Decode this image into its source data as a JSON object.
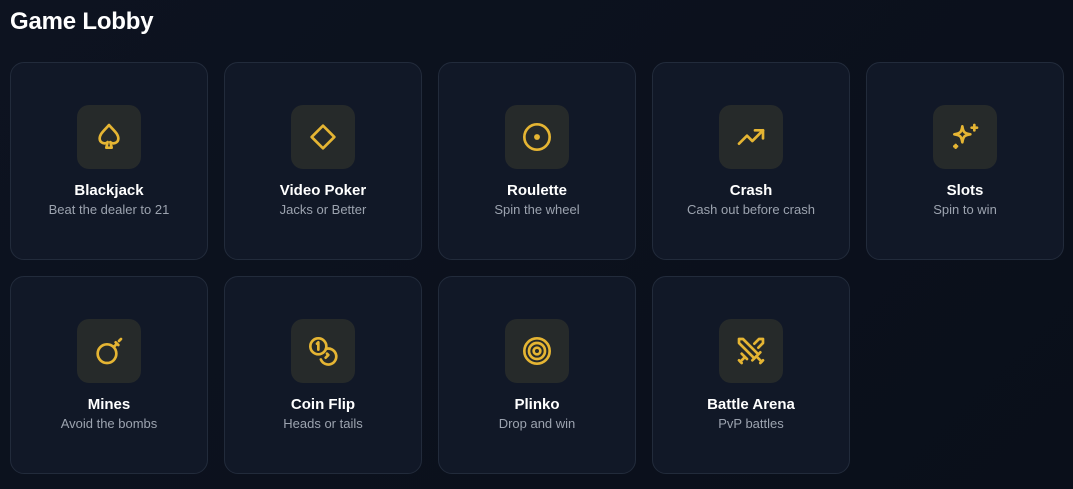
{
  "page": {
    "title": "Game Lobby"
  },
  "colors": {
    "accent": "#e5b533",
    "card_bg": "#111827",
    "icon_bg": "#262a2a",
    "subtitle": "#9ca3af"
  },
  "games": [
    {
      "title": "Blackjack",
      "subtitle": "Beat the dealer to 21",
      "icon": "spade-icon"
    },
    {
      "title": "Video Poker",
      "subtitle": "Jacks or Better",
      "icon": "diamond-icon"
    },
    {
      "title": "Roulette",
      "subtitle": "Spin the wheel",
      "icon": "circle-dot-icon"
    },
    {
      "title": "Crash",
      "subtitle": "Cash out before crash",
      "icon": "trending-up-icon"
    },
    {
      "title": "Slots",
      "subtitle": "Spin to win",
      "icon": "sparkles-icon"
    },
    {
      "title": "Mines",
      "subtitle": "Avoid the bombs",
      "icon": "bomb-icon"
    },
    {
      "title": "Coin Flip",
      "subtitle": "Heads or tails",
      "icon": "coins-icon"
    },
    {
      "title": "Plinko",
      "subtitle": "Drop and win",
      "icon": "target-icon"
    },
    {
      "title": "Battle Arena",
      "subtitle": "PvP battles",
      "icon": "swords-icon"
    }
  ]
}
